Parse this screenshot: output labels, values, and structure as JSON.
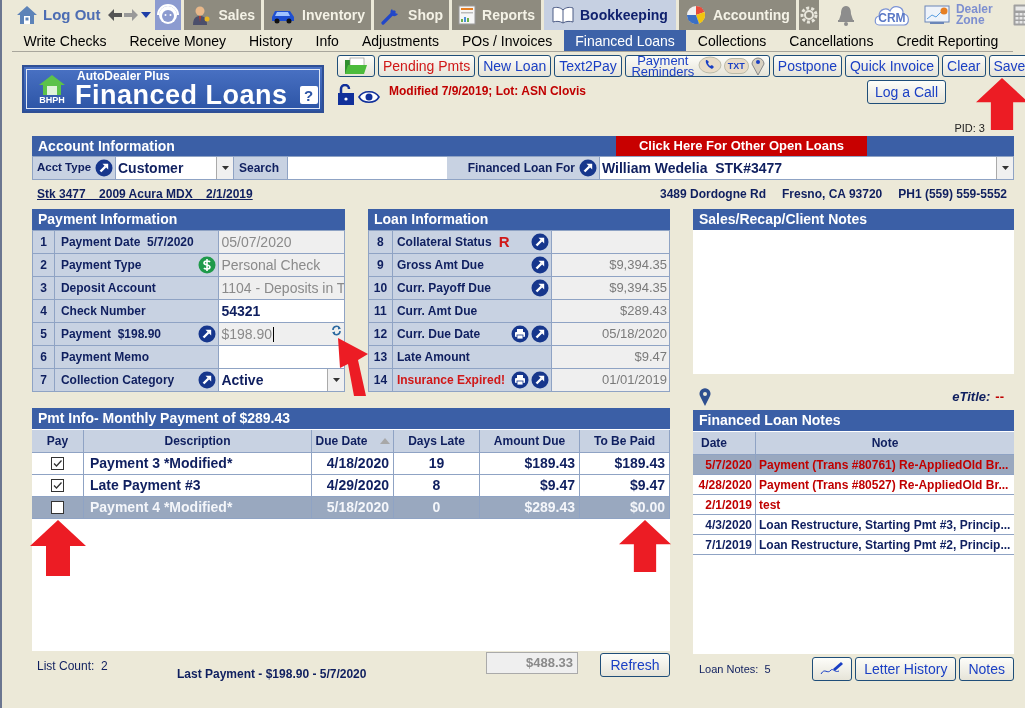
{
  "nav": {
    "logout": "Log Out",
    "tabs": [
      {
        "label": "Sales",
        "selected": false
      },
      {
        "label": "Inventory",
        "selected": false
      },
      {
        "label": "Shop",
        "selected": false
      },
      {
        "label": "Reports",
        "selected": false
      },
      {
        "label": "Bookkeeping",
        "selected": true
      },
      {
        "label": "Accounting",
        "selected": false
      }
    ],
    "crm": "CRM",
    "dealer_zone": "Dealer Zone"
  },
  "subnav": [
    {
      "label": "Write Checks",
      "selected": false
    },
    {
      "label": "Receive Money",
      "selected": false
    },
    {
      "label": "History",
      "selected": false
    },
    {
      "label": "Info",
      "selected": false
    },
    {
      "label": "Adjustments",
      "selected": false
    },
    {
      "label": "POs / Invoices",
      "selected": false
    },
    {
      "label": "Financed Loans",
      "selected": true
    },
    {
      "label": "Collections",
      "selected": false
    },
    {
      "label": "Cancellations",
      "selected": false
    },
    {
      "label": "Credit Reporting",
      "selected": false
    }
  ],
  "banner": {
    "brand": "AutoDealer Plus",
    "title": "Financed Loans",
    "badge": "BHPH",
    "help": "?"
  },
  "toolbar": [
    {
      "label": "Pending Pmts",
      "kind": "alert"
    },
    {
      "label": "New Loan",
      "kind": "normal"
    },
    {
      "label": "Text2Pay",
      "kind": "normal"
    },
    {
      "label": "Payment Reminders",
      "kind": "reminder",
      "badge": "TXT"
    },
    {
      "label": "Postpone",
      "kind": "normal"
    },
    {
      "label": "Quick Invoice",
      "kind": "normal"
    },
    {
      "label": "Clear",
      "kind": "normal"
    },
    {
      "label": "Save",
      "kind": "normal"
    }
  ],
  "log_call": "Log a Call",
  "modified": "Modified 7/9/2019; Lot: ASN Clovis",
  "pid": "PID: 3",
  "account": {
    "title": "Account Information",
    "other_loans": "Click Here For Other Open Loans",
    "acct_type_label": "Acct Type",
    "acct_type": "Customer",
    "search_label": "Search",
    "loan_for_label": "Financed Loan For",
    "loan_for": "William Wedelia  STK#3477"
  },
  "vehicle": "Stk 3477    2009 Acura MDX    2/1/2019",
  "address": [
    "3489 Dordogne Rd",
    "Fresno, CA 93720",
    "PH1 (559) 559-5552"
  ],
  "payment_info": {
    "title": "Payment Information",
    "rows": [
      {
        "num": "1",
        "label": "Payment Date  5/7/2020",
        "value": "05/07/2020",
        "kind": "readonly"
      },
      {
        "num": "2",
        "label": "Payment Type",
        "value": "Personal Check",
        "kind": "readonly"
      },
      {
        "num": "3",
        "label": "Deposit Account",
        "value": "1104 - Deposits in T",
        "kind": "readonly"
      },
      {
        "num": "4",
        "label": "Check Number",
        "value": "54321",
        "kind": "input"
      },
      {
        "num": "5",
        "label": "Payment  $198.90",
        "value": "$198.90",
        "kind": "readonly"
      },
      {
        "num": "6",
        "label": "Payment Memo",
        "kind": "input"
      },
      {
        "num": "7",
        "label": "Collection Category",
        "value": "Active",
        "kind": "select"
      }
    ]
  },
  "loan_info": {
    "title": "Loan Information",
    "rows": [
      {
        "num": "8",
        "label": "Collateral Status",
        "flag": "R",
        "alert": false
      },
      {
        "num": "9",
        "label": "Gross Amt Due",
        "value": "$9,394.35",
        "alert": false
      },
      {
        "num": "10",
        "label": "Curr. Payoff Due",
        "value": "$9,394.35",
        "alert": false
      },
      {
        "num": "11",
        "label": "Curr. Amt Due",
        "value": "$289.43",
        "alert": false
      },
      {
        "num": "12",
        "label": "Curr. Due Date",
        "value": "05/18/2020",
        "alert": false
      },
      {
        "num": "13",
        "label": "Late Amount",
        "value": "$9.47",
        "alert": false
      },
      {
        "num": "14",
        "label": "Insurance Expired!",
        "value": "01/01/2019",
        "alert": true
      }
    ]
  },
  "sales_notes": {
    "title": "Sales/Recap/Client Notes"
  },
  "etitle": {
    "label": "eTitle:",
    "value": "--"
  },
  "pmt_table": {
    "title": "Pmt Info- Monthly Payment of $289.43",
    "columns": [
      {
        "label": "Pay",
        "sorted": false
      },
      {
        "label": "Description",
        "sorted": false
      },
      {
        "label": "Due Date",
        "sorted": true
      },
      {
        "label": "Days Late",
        "sorted": false
      },
      {
        "label": "Amount Due",
        "sorted": false
      },
      {
        "label": "To Be Paid",
        "sorted": false
      }
    ],
    "rows": [
      {
        "checked": true,
        "selected": false,
        "description": "Payment 3 *Modified*",
        "due_date": "4/18/2020",
        "days_late": "19",
        "amount_due": "$189.43",
        "to_be_paid": "$189.43"
      },
      {
        "checked": true,
        "selected": false,
        "description": "Late Payment #3",
        "due_date": "4/29/2020",
        "days_late": "8",
        "amount_due": "$9.47",
        "to_be_paid": "$9.47"
      },
      {
        "checked": false,
        "selected": true,
        "description": "Payment 4 *Modified*",
        "due_date": "5/18/2020",
        "days_late": "0",
        "amount_due": "$289.43",
        "to_be_paid": "$0.00"
      }
    ]
  },
  "loan_notes": {
    "title": "Financed Loan Notes",
    "columns": [
      "Date",
      "Note"
    ],
    "rows": [
      {
        "date": "5/7/2020",
        "note": "Payment (Trans #80761) Re-AppliedOld Br...",
        "alert": true,
        "selected": true
      },
      {
        "date": "4/28/2020",
        "note": "Payment (Trans #80527) Re-AppliedOld Br...",
        "alert": true,
        "selected": false
      },
      {
        "date": "2/1/2019",
        "note": "test",
        "alert": true,
        "selected": false
      },
      {
        "date": "4/3/2020",
        "note": "Loan Restructure, Starting Pmt #3, Princip...",
        "alert": false,
        "selected": false
      },
      {
        "date": "7/1/2019",
        "note": "Loan Restructure, Starting Pmt #2, Princip...",
        "alert": false,
        "selected": false
      }
    ]
  },
  "footer": {
    "list_count": "List Count:  2",
    "last_payment": "Last Payment - $198.90 - 5/7/2020",
    "total": "$488.33",
    "refresh": "Refresh",
    "notes_count": "Loan Notes:  5",
    "buttons": [
      "Letter History",
      "Notes"
    ]
  }
}
